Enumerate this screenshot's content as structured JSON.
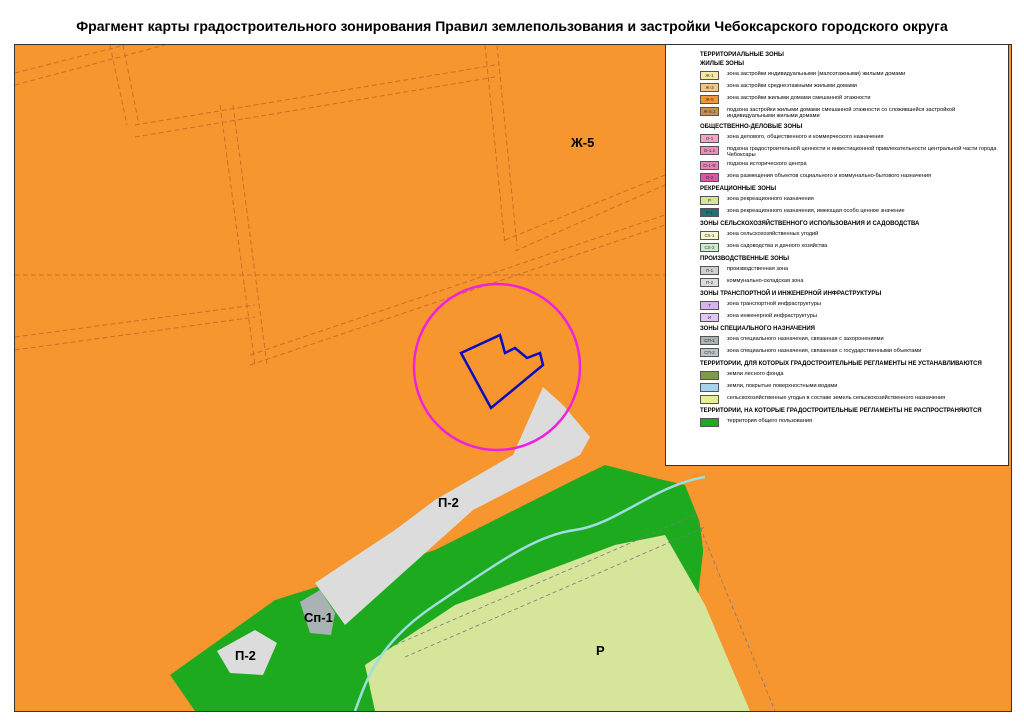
{
  "title": "Фрагмент карты градостроительного зонирования Правил землепользования и застройки Чебоксарского городского округа",
  "map": {
    "zone_labels": [
      "Ж-5",
      "П-2",
      "Сп-1",
      "П-2",
      "Р"
    ],
    "colors": {
      "residential": "#f7962f",
      "production": "#dcdcdc",
      "green": "#1eaa1e",
      "recreation": "#d5e59a",
      "special": "#a9b3b3",
      "parcel": "#0b0bbf",
      "circle": "#ee22dd",
      "river": "#9fdde0",
      "road": "#c8702a"
    }
  },
  "legend": {
    "sections": [
      {
        "title": "ТЕРРИТОРИАЛЬНЫЕ ЗОНЫ",
        "items": []
      },
      {
        "title": "ЖИЛЫЕ ЗОНЫ",
        "items": [
          {
            "code": "Ж-1",
            "color": "#f9e7a2",
            "text": "зона застройки индивидуальными (малоэтажными) жилыми домами"
          },
          {
            "code": "Ж-3",
            "color": "#f6c58a",
            "text": "зона застройки среднеэтажными жилыми домами"
          },
          {
            "code": "Ж-5",
            "color": "#f7962f",
            "text": "зона застройки жилыми домами смешанной этажности"
          },
          {
            "code": "Ж-5.1",
            "color": "#c98f55",
            "text": "подзона застройки жилыми домами смешанной этажности со сложившейся застройкой индивидуальными жилыми домами"
          }
        ]
      },
      {
        "title": "ОБЩЕСТВЕННО-ДЕЛОВЫЕ ЗОНЫ",
        "items": [
          {
            "code": "О-1",
            "color": "#f3a6c8",
            "text": "зона делового, общественного и коммерческого назначения"
          },
          {
            "code": "О-1.1",
            "color": "#e98fba",
            "text": "подзона градостроительной ценности и инвестиционной привлекательности центральной части города Чебоксары"
          },
          {
            "code": "О-1-Ф",
            "color": "#ea80b5",
            "text": "подзона исторического центра"
          },
          {
            "code": "О-2",
            "color": "#d957a5",
            "text": "зона размещения объектов социального и коммунально-бытового назначения"
          }
        ]
      },
      {
        "title": "РЕКРЕАЦИОННЫЕ ЗОНЫ",
        "items": [
          {
            "code": "Р",
            "color": "#d5e59a",
            "text": "зона рекреационного назначения"
          },
          {
            "code": "Р-1",
            "color": "#1f7373",
            "text": "зона рекреационного назначения, имеющая особо ценное значение"
          }
        ]
      },
      {
        "title": "ЗОНЫ СЕЛЬСКОХОЗЯЙСТВЕННОГО ИСПОЛЬЗОВАНИЯ И САДОВОДСТВА",
        "items": [
          {
            "code": "СХ-1",
            "color": "#f6f6cf",
            "text": "зона сельскохозяйственных угодий"
          },
          {
            "code": "СХ-2",
            "color": "#cdeccd",
            "text": "зона садоводства и дачного хозяйства"
          }
        ]
      },
      {
        "title": "ПРОИЗВОДСТВЕННЫЕ ЗОНЫ",
        "items": [
          {
            "code": "П-1",
            "color": "#cfcfcf",
            "text": "производственная зона"
          },
          {
            "code": "П-2",
            "color": "#dcdcdc",
            "text": "коммунально-складская зона"
          }
        ]
      },
      {
        "title": "ЗОНЫ ТРАНСПОРТНОЙ И ИНЖЕНЕРНОЙ ИНФРАСТРУКТУРЫ",
        "items": [
          {
            "code": "Т",
            "color": "#d9b3f0",
            "text": "зона транспортной инфраструктуры"
          },
          {
            "code": "И",
            "color": "#e2c6f5",
            "text": "зона инженерной инфраструктуры"
          }
        ]
      },
      {
        "title": "ЗОНЫ СПЕЦИАЛЬНОГО НАЗНАЧЕНИЯ",
        "items": [
          {
            "code": "СП-1",
            "color": "#a9b3b3",
            "text": "зона специального назначения, связанная с захоронениями"
          },
          {
            "code": "СП-2",
            "color": "#bcc3c9",
            "text": "зона специального назначения, связанная с государственными объектами"
          }
        ]
      },
      {
        "title": "ТЕРРИТОРИИ, ДЛЯ КОТОРЫХ ГРАДОСТРОИТЕЛЬНЫЕ РЕГЛАМЕНТЫ НЕ УСТАНАВЛИВАЮТСЯ",
        "items": [
          {
            "code": "",
            "color": "#7f9a4c",
            "text": "земли лесного фонда"
          },
          {
            "code": "",
            "color": "#a9d3ec",
            "text": "земли, покрытые поверхностными водами"
          },
          {
            "code": "",
            "color": "#e6ef96",
            "text": "сельскохозяйственные угодья в составе земель сельскохозяйственного назначения"
          }
        ]
      },
      {
        "title": "ТЕРРИТОРИИ, НА КОТОРЫЕ ГРАДОСТРОИТЕЛЬНЫЕ РЕГЛАМЕНТЫ НЕ РАСПРОСТРАНЯЮТСЯ",
        "items": [
          {
            "code": "",
            "color": "#1eaa1e",
            "text": "территория общего пользования"
          }
        ]
      }
    ]
  }
}
